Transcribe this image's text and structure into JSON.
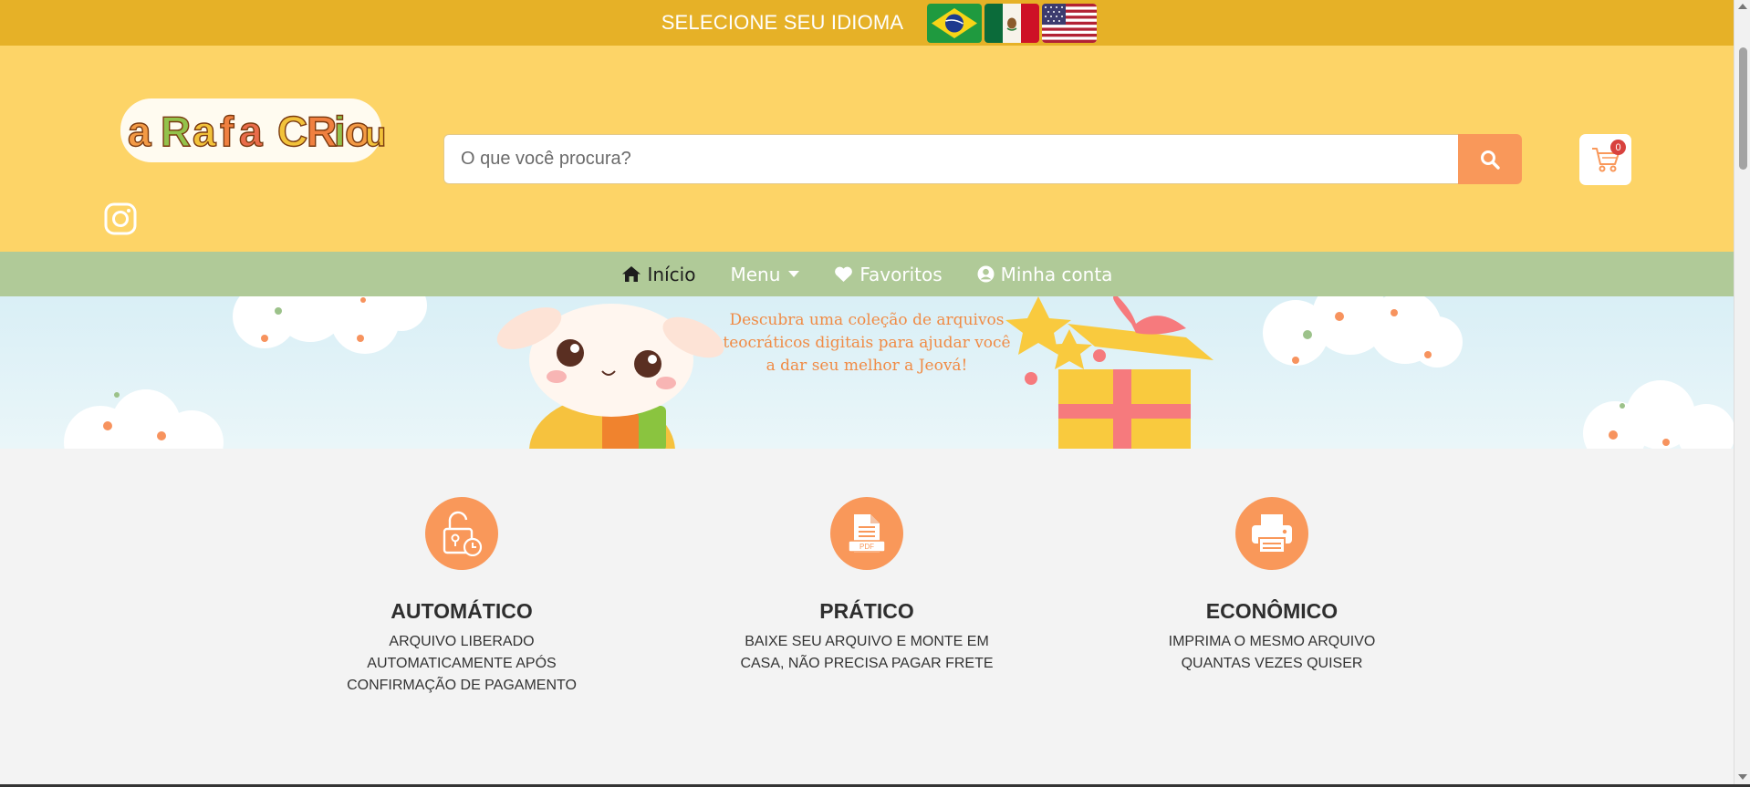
{
  "language_bar": {
    "label": "SELECIONE SEU IDIOMA",
    "flags": [
      {
        "name": "brazil-flag",
        "colors": [
          "#1f9a3f",
          "#f7d417",
          "#1d3a8f"
        ]
      },
      {
        "name": "mexico-flag",
        "colors": [
          "#0b6b3a",
          "#ffffff",
          "#ce1126"
        ]
      },
      {
        "name": "usa-flag",
        "colors": [
          "#b22234",
          "#ffffff",
          "#3c3b6e"
        ]
      }
    ],
    "background": "#e6b127"
  },
  "header": {
    "logo_text": "a Rafa Criou",
    "search_placeholder": "O que você procura?",
    "cart_count": "0",
    "background": "#fdd467",
    "accent": "#f9985a"
  },
  "nav": {
    "items": [
      {
        "label": "Início",
        "icon": "home-icon",
        "active": true
      },
      {
        "label": "Menu",
        "icon": "caret-down-icon"
      },
      {
        "label": "Favoritos",
        "icon": "heart-icon"
      },
      {
        "label": "Minha conta",
        "icon": "user-circle-icon"
      }
    ],
    "background": "#b0ca98"
  },
  "banner": {
    "text": "Descubra uma coleção de arquivos teocráticos digitais para ajudar você a dar seu melhor a Jeová!"
  },
  "features": [
    {
      "title": "AUTOMÁTICO",
      "description": "ARQUIVO LIBERADO AUTOMATICAMENTE APÓS CONFIRMAÇÃO DE PAGAMENTO",
      "icon": "unlock-clock-icon"
    },
    {
      "title": "PRÁTICO",
      "description": "BAIXE SEU ARQUIVO E MONTE EM CASA, NÃO PRECISA PAGAR FRETE",
      "icon": "pdf-file-icon",
      "icon_text": "PDF"
    },
    {
      "title": "ECONÔMICO",
      "description": "IMPRIMA O MESMO ARQUIVO QUANTAS VEZES QUISER",
      "icon": "printer-icon"
    }
  ]
}
